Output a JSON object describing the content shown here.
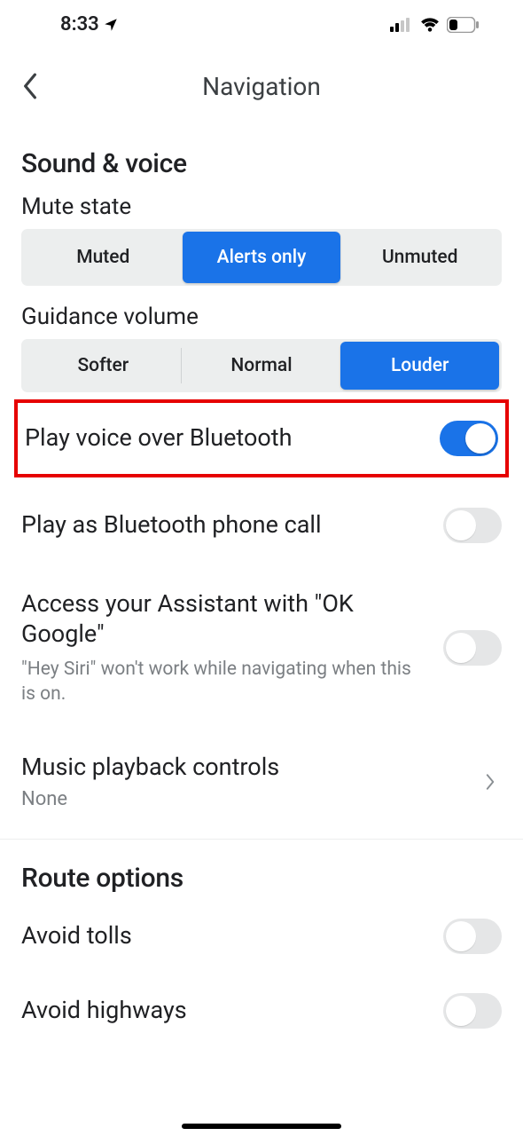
{
  "status": {
    "time": "8:33"
  },
  "header": {
    "title": "Navigation"
  },
  "sound": {
    "heading": "Sound & voice",
    "muteLabel": "Mute state",
    "muteOptions": {
      "muted": "Muted",
      "alerts": "Alerts only",
      "unmuted": "Unmuted"
    },
    "guidanceLabel": "Guidance volume",
    "guidanceOptions": {
      "softer": "Softer",
      "normal": "Normal",
      "louder": "Louder"
    }
  },
  "rows": {
    "bluetooth": {
      "title": "Play voice over Bluetooth"
    },
    "phonecall": {
      "title": "Play as Bluetooth phone call"
    },
    "assistant": {
      "title": "Access your Assistant with \"OK Google\"",
      "sub": "\"Hey Siri\" won't work while navigating when this is on."
    },
    "music": {
      "title": "Music playback controls",
      "value": "None"
    }
  },
  "route": {
    "heading": "Route options",
    "tolls": "Avoid tolls",
    "highways": "Avoid highways"
  }
}
